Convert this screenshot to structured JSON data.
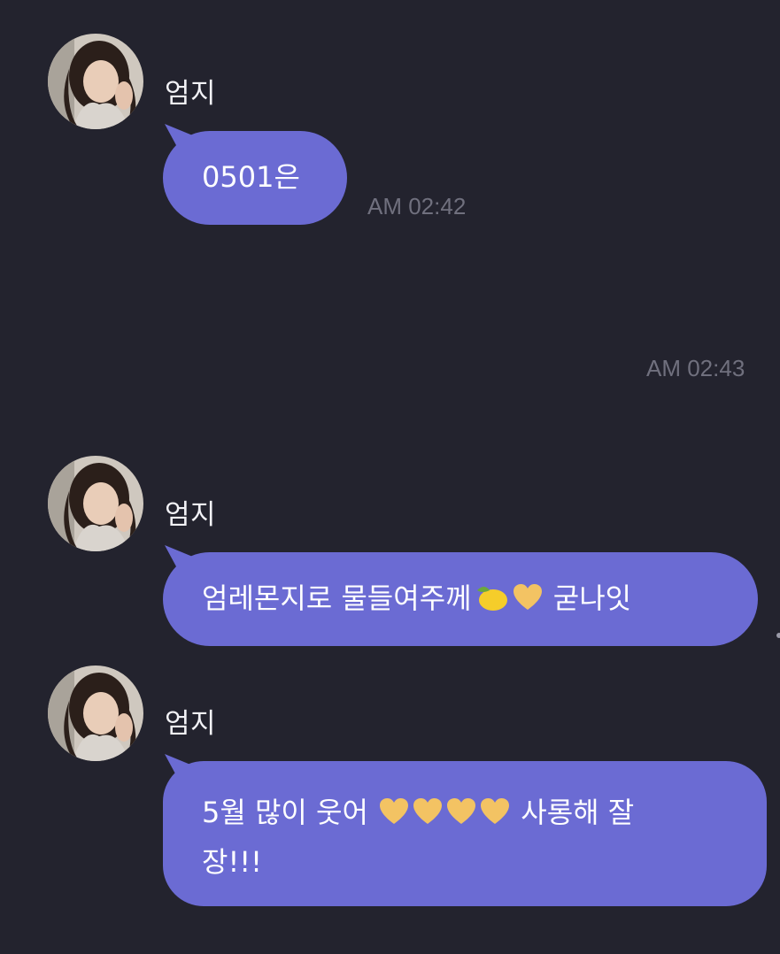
{
  "chat": {
    "messages": [
      {
        "sender": "엄지",
        "text": "0501은",
        "time": "AM 02:42"
      },
      {
        "time": "AM 02:43"
      },
      {
        "sender": "엄지",
        "text_before": "엄레몬지로 물들여주께",
        "emoji": [
          "lemon-emoji",
          "yellow-heart-emoji"
        ],
        "text_after": " 굳나잇"
      },
      {
        "sender": "엄지",
        "line1_before": "5월 많이 웃어 ",
        "hearts": [
          "yellow-heart-emoji",
          "yellow-heart-emoji",
          "yellow-heart-emoji",
          "yellow-heart-emoji"
        ],
        "line1_after": " 사롱해 잘",
        "line2": "장!!!"
      }
    ]
  },
  "colors": {
    "background": "#23232e",
    "bubble": "#6b6bd3",
    "timestamp": "#70707e",
    "heart": "#f3c363"
  }
}
